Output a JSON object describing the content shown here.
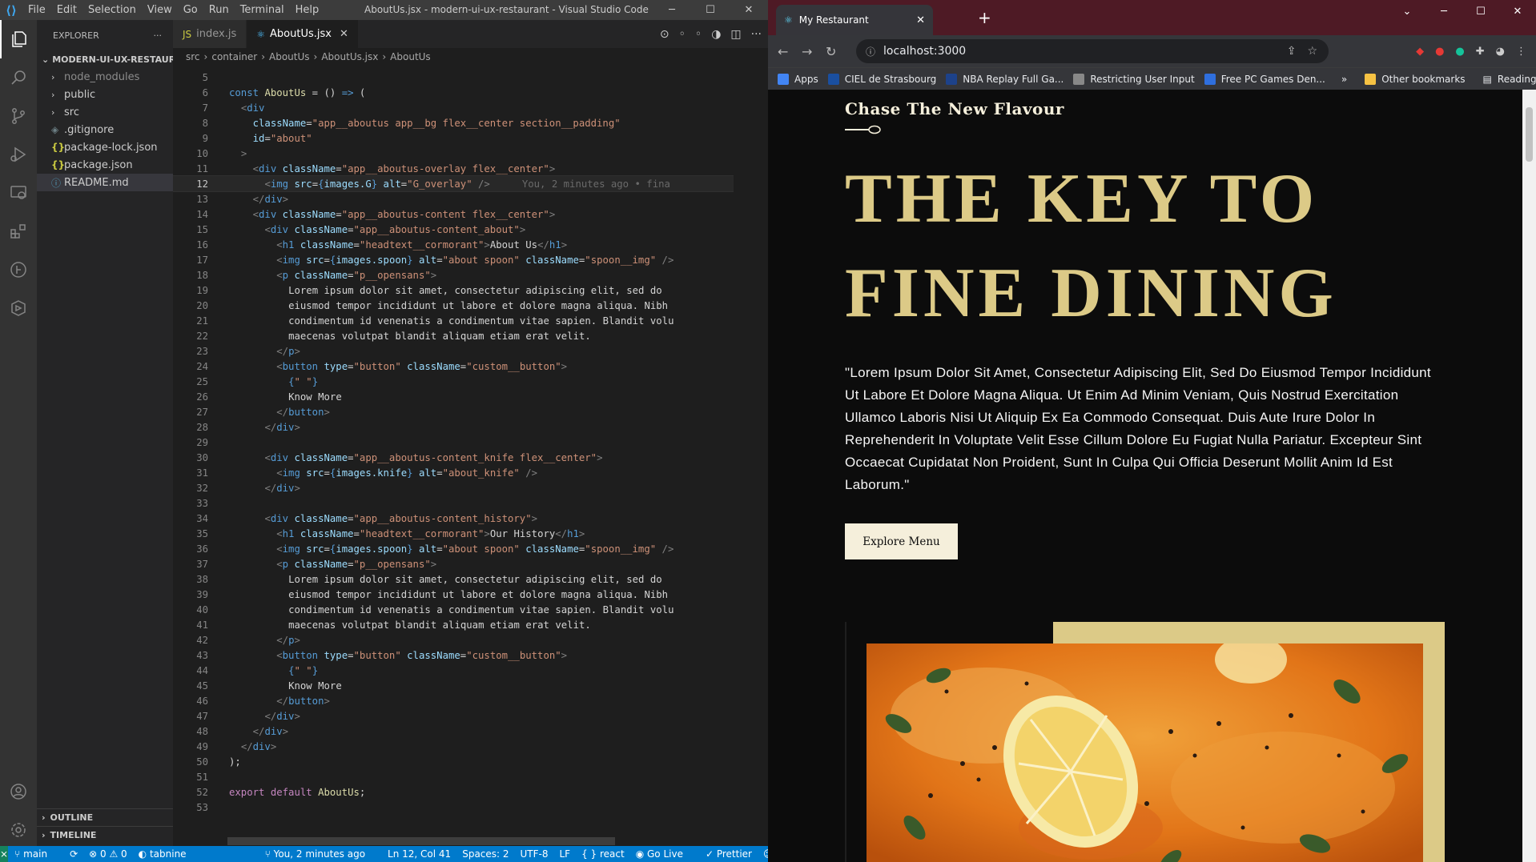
{
  "vscode": {
    "menu": [
      "File",
      "Edit",
      "Selection",
      "View",
      "Go",
      "Run",
      "Terminal",
      "Help"
    ],
    "window_title": "AboutUs.jsx - modern-ui-ux-restaurant - Visual Studio Code",
    "explorer_label": "EXPLORER",
    "project": "MODERN-UI-UX-RESTAUR...",
    "tree": [
      {
        "label": "node_modules",
        "type": "folder",
        "dim": true
      },
      {
        "label": "public",
        "type": "folder"
      },
      {
        "label": "src",
        "type": "folder"
      },
      {
        "label": ".gitignore",
        "type": "git"
      },
      {
        "label": "package-lock.json",
        "type": "json"
      },
      {
        "label": "package.json",
        "type": "json"
      },
      {
        "label": "README.md",
        "type": "info",
        "selected": true
      }
    ],
    "outline_label": "OUTLINE",
    "timeline_label": "TIMELINE",
    "tabs": [
      {
        "label": "index.js",
        "icon": "JS",
        "active": false
      },
      {
        "label": "AboutUs.jsx",
        "icon": "⚛",
        "active": true
      }
    ],
    "breadcrumb": [
      "src",
      "container",
      "AboutUs",
      "AboutUs.jsx",
      "AboutUs"
    ],
    "git_blame": "You, 2 minutes ago • fina",
    "code_lines": [
      {
        "n": "5",
        "t": ""
      },
      {
        "n": "6",
        "t": "const AboutUs = () => ("
      },
      {
        "n": "7",
        "t": "  <div"
      },
      {
        "n": "8",
        "t": "    className=\"app__aboutus app__bg flex__center section__padding\""
      },
      {
        "n": "9",
        "t": "    id=\"about\""
      },
      {
        "n": "10",
        "t": "  >"
      },
      {
        "n": "11",
        "t": "    <div className=\"app__aboutus-overlay flex__center\">"
      },
      {
        "n": "12",
        "t": "      <img src={images.G} alt=\"G_overlay\" />"
      },
      {
        "n": "13",
        "t": "    </div>"
      },
      {
        "n": "14",
        "t": "    <div className=\"app__aboutus-content flex__center\">"
      },
      {
        "n": "15",
        "t": "      <div className=\"app__aboutus-content_about\">"
      },
      {
        "n": "16",
        "t": "        <h1 className=\"headtext__cormorant\">About Us</h1>"
      },
      {
        "n": "17",
        "t": "        <img src={images.spoon} alt=\"about spoon\" className=\"spoon__img\" />"
      },
      {
        "n": "18",
        "t": "        <p className=\"p__opensans\">"
      },
      {
        "n": "19",
        "t": "          Lorem ipsum dolor sit amet, consectetur adipiscing elit, sed do"
      },
      {
        "n": "20",
        "t": "          eiusmod tempor incididunt ut labore et dolore magna aliqua. Nibh"
      },
      {
        "n": "21",
        "t": "          condimentum id venenatis a condimentum vitae sapien. Blandit volu"
      },
      {
        "n": "22",
        "t": "          maecenas volutpat blandit aliquam etiam erat velit."
      },
      {
        "n": "23",
        "t": "        </p>"
      },
      {
        "n": "24",
        "t": "        <button type=\"button\" className=\"custom__button\">"
      },
      {
        "n": "25",
        "t": "          {\" \"}"
      },
      {
        "n": "26",
        "t": "          Know More"
      },
      {
        "n": "27",
        "t": "        </button>"
      },
      {
        "n": "28",
        "t": "      </div>"
      },
      {
        "n": "29",
        "t": ""
      },
      {
        "n": "30",
        "t": "      <div className=\"app__aboutus-content_knife flex__center\">"
      },
      {
        "n": "31",
        "t": "        <img src={images.knife} alt=\"about_knife\" />"
      },
      {
        "n": "32",
        "t": "      </div>"
      },
      {
        "n": "33",
        "t": ""
      },
      {
        "n": "34",
        "t": "      <div className=\"app__aboutus-content_history\">"
      },
      {
        "n": "35",
        "t": "        <h1 className=\"headtext__cormorant\">Our History</h1>"
      },
      {
        "n": "36",
        "t": "        <img src={images.spoon} alt=\"about spoon\" className=\"spoon__img\" />"
      },
      {
        "n": "37",
        "t": "        <p className=\"p__opensans\">"
      },
      {
        "n": "38",
        "t": "          Lorem ipsum dolor sit amet, consectetur adipiscing elit, sed do"
      },
      {
        "n": "39",
        "t": "          eiusmod tempor incididunt ut labore et dolore magna aliqua. Nibh"
      },
      {
        "n": "40",
        "t": "          condimentum id venenatis a condimentum vitae sapien. Blandit volu"
      },
      {
        "n": "41",
        "t": "          maecenas volutpat blandit aliquam etiam erat velit."
      },
      {
        "n": "42",
        "t": "        </p>"
      },
      {
        "n": "43",
        "t": "        <button type=\"button\" className=\"custom__button\">"
      },
      {
        "n": "44",
        "t": "          {\" \"}"
      },
      {
        "n": "45",
        "t": "          Know More"
      },
      {
        "n": "46",
        "t": "        </button>"
      },
      {
        "n": "47",
        "t": "      </div>"
      },
      {
        "n": "48",
        "t": "    </div>"
      },
      {
        "n": "49",
        "t": "  </div>"
      },
      {
        "n": "50",
        "t": ");"
      },
      {
        "n": "51",
        "t": ""
      },
      {
        "n": "52",
        "t": "export default AboutUs;"
      },
      {
        "n": "53",
        "t": ""
      }
    ],
    "current_line": "12",
    "status": {
      "branch": "main",
      "problems": "⊗ 0 ⚠ 0",
      "tabnine": "tabnine",
      "blame": "You, 2 minutes ago",
      "position": "Ln 12, Col 41",
      "spaces": "Spaces: 2",
      "encoding": "UTF-8",
      "eol": "LF",
      "language": "{ } react",
      "golive": "Go Live",
      "prettier": "✓ Prettier"
    }
  },
  "browser": {
    "tab_title": "My Restaurant",
    "url": "localhost:3000",
    "bookmarks": [
      {
        "label": "Apps",
        "color": "#4285f4"
      },
      {
        "label": "CIEL de Strasbourg",
        "color": "#1a4fa0"
      },
      {
        "label": "NBA Replay Full Ga...",
        "color": "#1d428a"
      },
      {
        "label": "Restricting User Input",
        "color": "#888888"
      },
      {
        "label": "Free PC Games Den...",
        "color": "#2f6fde"
      }
    ],
    "more_bookmarks": "»",
    "other_bookmarks": "Other bookmarks",
    "reading_list": "Reading list",
    "page": {
      "subtitle": "Chase The New Flavour",
      "hero_line1": "THE KEY TO",
      "hero_line2": "FINE DINING",
      "paragraph": "\"Lorem Ipsum Dolor Sit Amet, Consectetur Adipiscing Elit, Sed Do Eiusmod Tempor Incididunt Ut Labore Et Dolore Magna Aliqua. Ut Enim Ad Minim Veniam, Quis Nostrud Exercitation Ullamco Laboris Nisi Ut Aliquip Ex Ea Commodo Consequat. Duis Aute Irure Dolor In Reprehenderit In Voluptate Velit Esse Cillum Dolore Eu Fugiat Nulla Pariatur. Excepteur Sint Occaecat Cupidatat Non Proident, Sunt In Culpa Qui Officia Deserunt Mollit Anim Id Est Laborum.\"",
      "button": "Explore Menu",
      "gold": "#dcca87",
      "cream": "#f5efdb"
    }
  }
}
